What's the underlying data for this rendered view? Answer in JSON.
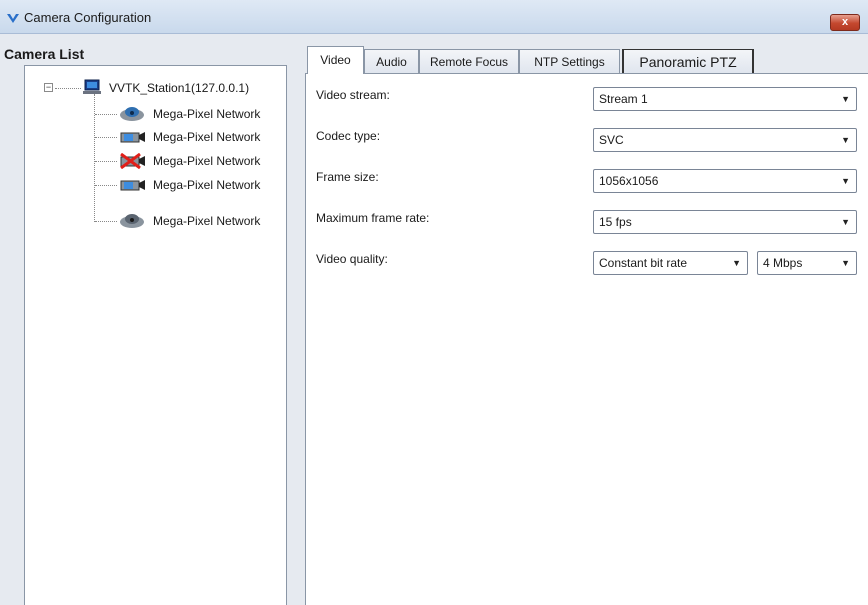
{
  "window": {
    "title": "Camera Configuration",
    "close_label": "x"
  },
  "camera_list": {
    "heading": "Camera List",
    "station": {
      "label": "VVTK_Station1(127.0.0.1)",
      "expander": "−"
    },
    "cameras": [
      {
        "label": "Mega-Pixel Network",
        "icon": "dome-camera-icon"
      },
      {
        "label": "Mega-Pixel Network",
        "icon": "box-camera-icon"
      },
      {
        "label": "Mega-Pixel Network",
        "icon": "camera-disconnected-icon"
      },
      {
        "label": "Mega-Pixel Network",
        "icon": "box-camera-icon"
      },
      {
        "label": "Mega-Pixel Network",
        "icon": "dome-camera-icon"
      }
    ]
  },
  "tabs": [
    {
      "label": "Video",
      "active": true
    },
    {
      "label": "Audio",
      "active": false
    },
    {
      "label": "Remote Focus",
      "active": false
    },
    {
      "label": "NTP Settings",
      "active": false
    },
    {
      "label": "Panoramic PTZ",
      "active": false
    }
  ],
  "video": {
    "stream_label": "Video stream:",
    "stream_value": "Stream 1",
    "codec_label": "Codec type:",
    "codec_value": "SVC",
    "frame_size_label": "Frame size:",
    "frame_size_value": "1056x1056",
    "max_rate_label": "Maximum frame rate:",
    "max_rate_value": "15 fps",
    "quality_label": "Video quality:",
    "quality_mode_value": "Constant bit rate",
    "quality_bitrate_value": "4 Mbps"
  },
  "colors": {
    "titlebar": "#c9d9ec",
    "close": "#c4482f",
    "panel_bg": "#e6eaf0"
  }
}
